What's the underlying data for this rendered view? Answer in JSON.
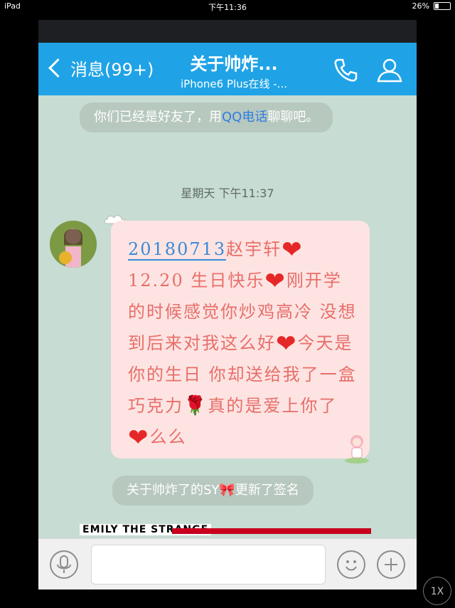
{
  "status": {
    "device": "iPad",
    "time": "下午11:36",
    "battery": "26%",
    "battery_level": 0.26
  },
  "nav": {
    "back_label": "消息(99+)",
    "title": "关于帅炸...",
    "subtitle": "iPhone6 Plus在线 -..."
  },
  "system": {
    "friend_prefix": "你们已经是好友了，用",
    "friend_link": "QQ电话",
    "friend_suffix": "聊聊吧。",
    "signature": "关于帅炸了的SY🎀更新了签名"
  },
  "timestamp": "星期天 下午11:37",
  "message": {
    "link": "20180713",
    "part1": "赵宇轩",
    "part2": "12.20 生日快乐",
    "part3": "刚开学的时候感觉你炒鸡高冷 没想到后来对我这么好",
    "part4": "今天是你的生日 你却送给我了一盒巧克力",
    "part5": "真的是爱上你了",
    "part6": "么么"
  },
  "banner": {
    "logo": "EMILY THE STRANGE"
  },
  "input": {
    "placeholder": ""
  },
  "overlay": {
    "zoom": "1X"
  },
  "colors": {
    "nav": "#1fa3e6",
    "chat_bg": "#c7dcd2",
    "bubble": "#fde4e2",
    "text": "#e86e6a"
  }
}
